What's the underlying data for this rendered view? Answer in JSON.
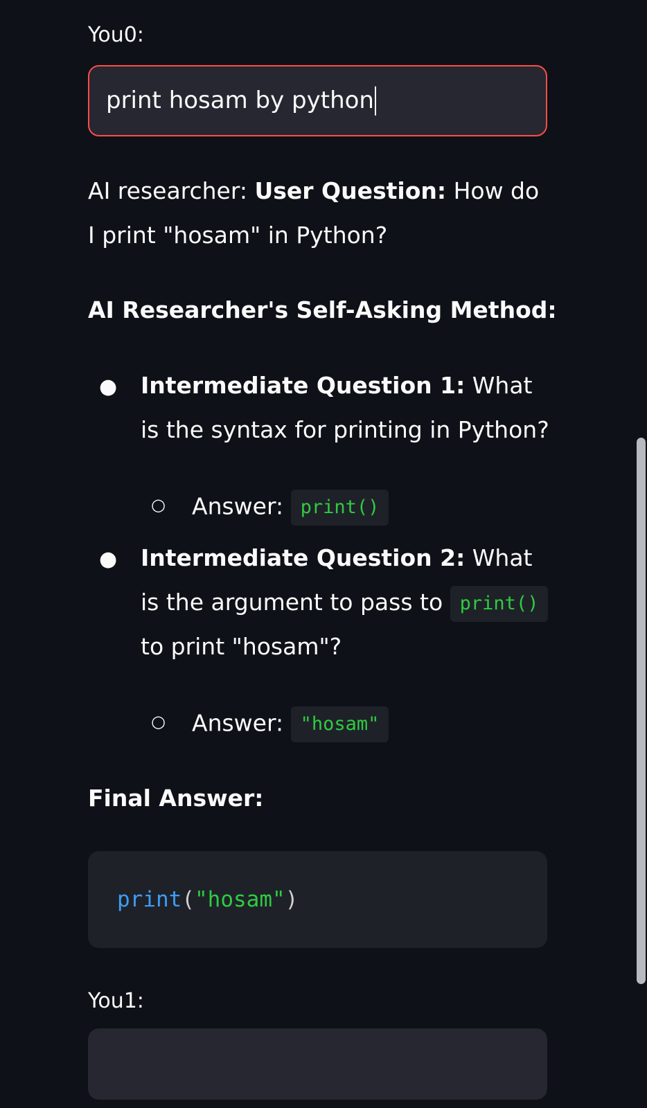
{
  "chat": {
    "turn0": {
      "label": "You0:",
      "input_value": "print hosam by python"
    },
    "response": {
      "prefix": "AI researcher: ",
      "question_label": "User Question:",
      "question_text": " How do I print \"hosam\" in Python?",
      "method_heading": "AI Researcher's Self-Asking Method:",
      "items": [
        {
          "bullet": "●",
          "label": "Intermediate Question 1:",
          "text": " What is the syntax for printing in Python?",
          "answer_bullet": "○",
          "answer_label": "Answer:",
          "answer_code": "print()"
        },
        {
          "bullet": "●",
          "label": "Intermediate Question 2:",
          "text_before": " What is the argument to pass to ",
          "text_code": "print()",
          "text_after": " to print \"hosam\"?",
          "answer_bullet": "○",
          "answer_label": "Answer:",
          "answer_code": "\"hosam\""
        }
      ],
      "final_heading": "Final Answer:",
      "final_code": {
        "keyword": "print",
        "open": "(",
        "string": "\"hosam\"",
        "close": ")"
      }
    },
    "turn1": {
      "label": "You1:",
      "input_value": ""
    }
  },
  "colors": {
    "background": "#0e1117",
    "input_background": "#262730",
    "focus_border": "#ff4b4b",
    "code_string": "#2ecc40",
    "code_keyword": "#3d9df5"
  }
}
